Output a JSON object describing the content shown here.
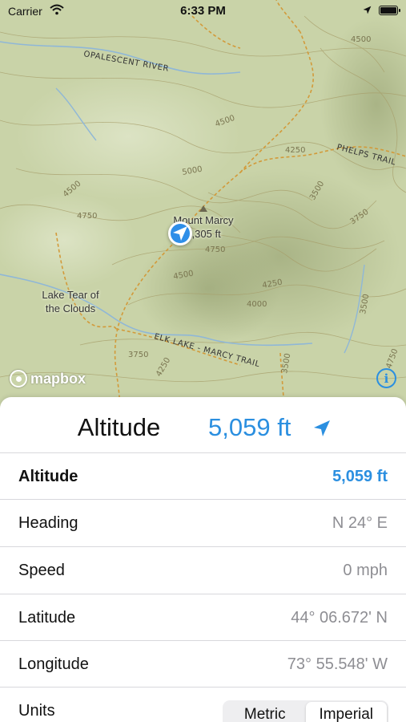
{
  "status": {
    "carrier": "Carrier",
    "time": "6:33 PM"
  },
  "map": {
    "labels": {
      "river": "OPALESCENT RIVER",
      "phelps_trail": "PHELPS TRAIL",
      "elk_lake_trail": "ELK LAKE - MARCY TRAIL",
      "summit_line1": "Mount Marcy",
      "summit_line2": "5,305 ft",
      "lake_line1": "Lake Tear of",
      "lake_line2": "the Clouds"
    },
    "contours": [
      "4500",
      "4500",
      "4750",
      "5000",
      "4500",
      "4750",
      "4250",
      "3500",
      "3750",
      "4500",
      "4250",
      "4000",
      "4750",
      "4250",
      "3500",
      "3500",
      "3750"
    ],
    "attribution": "mapbox",
    "info": "i",
    "colors": {
      "terrain": "#c9d3a8",
      "contour": "#a79e6a",
      "trail": "#d29a3a",
      "water": "#8fb7d7",
      "accent": "#2b8fe0"
    }
  },
  "sheet": {
    "title": "Altitude",
    "value": "5,059 ft",
    "arrow_icon": "location-arrow-icon",
    "rows": [
      {
        "label": "Altitude",
        "value": "5,059 ft"
      },
      {
        "label": "Heading",
        "value": "N 24° E"
      },
      {
        "label": "Speed",
        "value": "0 mph"
      },
      {
        "label": "Latitude",
        "value": "44° 06.672' N"
      },
      {
        "label": "Longitude",
        "value": "73° 55.548' W"
      }
    ],
    "units": {
      "label": "Units",
      "options": [
        "Metric",
        "Imperial"
      ],
      "selected": "Imperial"
    }
  }
}
